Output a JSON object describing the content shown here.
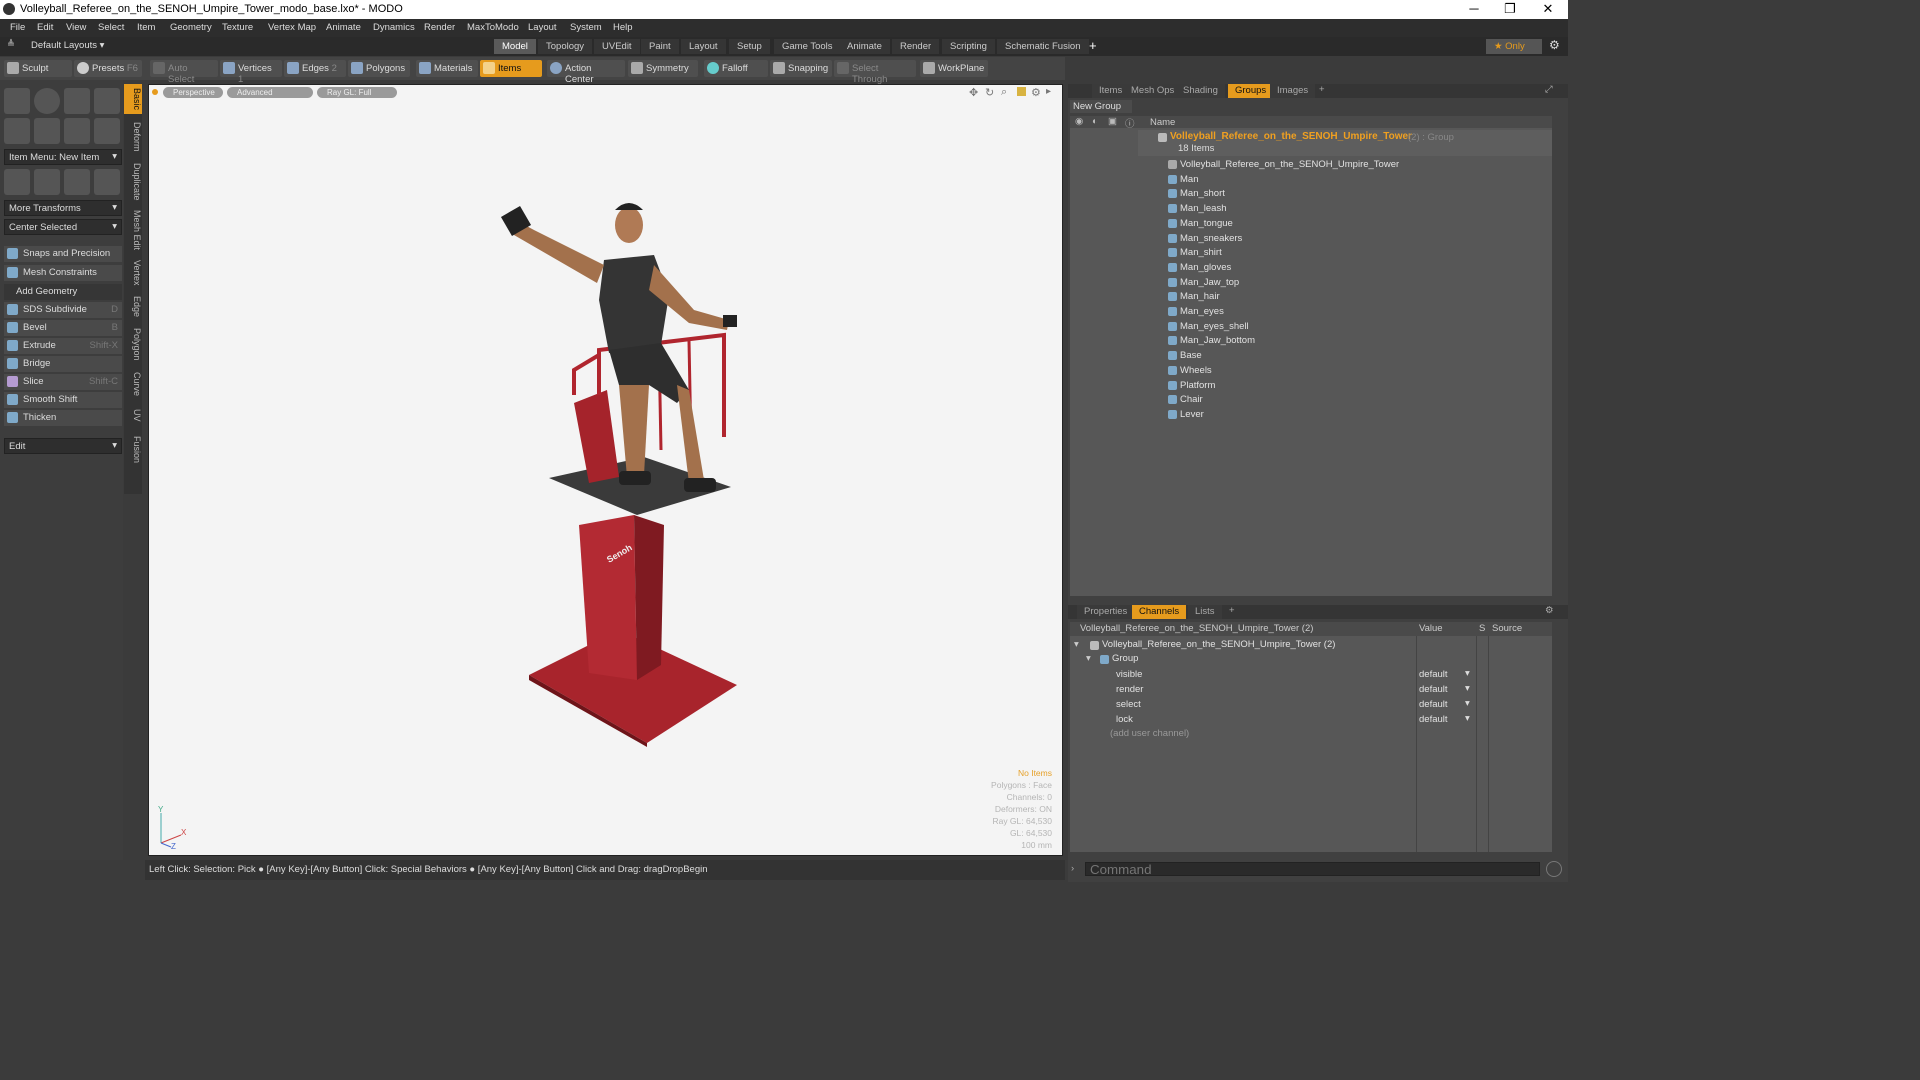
{
  "window": {
    "title": "Volleyball_Referee_on_the_SENOH_Umpire_Tower_modo_base.lxo* - MODO",
    "minimize": "─",
    "restore": "❐",
    "close": "✕"
  },
  "menu": [
    "File",
    "Edit",
    "View",
    "Select",
    "Item",
    "Geometry",
    "Texture",
    "Vertex Map",
    "Animate",
    "Dynamics",
    "Render",
    "MaxToModo",
    "Layout",
    "System",
    "Help"
  ],
  "layouts": {
    "default_label": "Default Layouts ▾",
    "tabs": [
      "Model",
      "Topology",
      "UVEdit",
      "Paint",
      "Layout",
      "Setup",
      "Game Tools",
      "Animate",
      "Render",
      "Scripting",
      "Schematic Fusion"
    ],
    "active": "Model",
    "plus": "+",
    "only": "★ Only"
  },
  "toolbar": {
    "sculpt": "Sculpt",
    "presets": "Presets",
    "presets_key": "F6",
    "auto_select": "Auto Select",
    "vertices": "Vertices",
    "vertices_count": "1",
    "edges": "Edges",
    "edges_count": "2",
    "polygons": "Polygons",
    "materials": "Materials",
    "items": "Items",
    "action_center": "Action Center",
    "symmetry": "Symmetry",
    "falloff": "Falloff",
    "snapping": "Snapping",
    "select_through": "Select Through",
    "workplane": "WorkPlane"
  },
  "leftpanel": {
    "vtabs": [
      "Basic",
      "Deform",
      "Duplicate",
      "Mesh Edit",
      "Vertex",
      "Edge",
      "Polygon",
      "Curve",
      "UV",
      "Fusion"
    ],
    "item_menu": "Item Menu: New Item",
    "more_transforms": "More Transforms",
    "center_selected": "Center Selected",
    "snaps": "Snaps and Precision",
    "mesh_constraints": "Mesh Constraints",
    "add_geometry": "Add Geometry",
    "tools": [
      {
        "label": "SDS Subdivide",
        "key": "D"
      },
      {
        "label": "Bevel",
        "key": "B"
      },
      {
        "label": "Extrude",
        "key": "Shift-X"
      },
      {
        "label": "Bridge",
        "key": ""
      },
      {
        "label": "Slice",
        "key": "Shift-C"
      },
      {
        "label": "Smooth Shift",
        "key": ""
      },
      {
        "label": "Thicken",
        "key": ""
      }
    ],
    "edit": "Edit"
  },
  "viewport": {
    "perspective": "Perspective",
    "advanced": "Advanced",
    "raygl": "Ray GL: Full",
    "hud": [
      "No Items",
      "Polygons : Face",
      "Channels: 0",
      "Deformers: ON",
      "Ray GL: 64,530",
      "GL: 64,530",
      "100 mm"
    ],
    "axis_y": "Y",
    "axis_x": "X",
    "axis_z": "Z",
    "brand": "Senoh"
  },
  "status": "Left Click: Selection: Pick ● [Any Key]-[Any Button] Click: Special Behaviors ● [Any Key]-[Any Button] Click and Drag: dragDropBegin",
  "groups": {
    "tabs": [
      "Items",
      "Mesh Ops",
      "Shading",
      "Groups",
      "Images"
    ],
    "active": "Groups",
    "new_group": "New Group",
    "name_header": "Name",
    "root": "Volleyball_Referee_on_the_SENOH_Umpire_Tower",
    "root_suffix": "(2) : Group",
    "count": "18 Items",
    "items": [
      "Volleyball_Referee_on_the_SENOH_Umpire_Tower",
      "Man",
      "Man_short",
      "Man_leash",
      "Man_tongue",
      "Man_sneakers",
      "Man_shirt",
      "Man_gloves",
      "Man_Jaw_top",
      "Man_hair",
      "Man_eyes",
      "Man_eyes_shell",
      "Man_Jaw_bottom",
      "Base",
      "Wheels",
      "Platform",
      "Chair",
      "Lever"
    ]
  },
  "channels": {
    "tabs": [
      "Properties",
      "Channels",
      "Lists"
    ],
    "active": "Channels",
    "header_name": "Volleyball_Referee_on_the_SENOH_Umpire_Tower (2)",
    "header_value": "Value",
    "header_s": "S",
    "header_source": "Source",
    "item": "Volleyball_Referee_on_the_SENOH_Umpire_Tower (2)",
    "group": "Group",
    "rows": [
      {
        "name": "visible",
        "value": "default"
      },
      {
        "name": "render",
        "value": "default"
      },
      {
        "name": "select",
        "value": "default"
      },
      {
        "name": "lock",
        "value": "default"
      }
    ],
    "add": "(add user channel)"
  },
  "command": {
    "placeholder": "Command"
  }
}
